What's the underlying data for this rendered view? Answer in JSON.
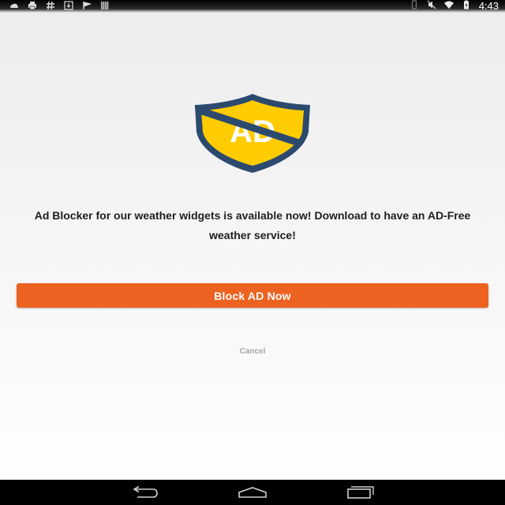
{
  "status_bar": {
    "time": "4:43",
    "left_icons": [
      "cloud-icon",
      "printer-icon",
      "hash-icon",
      "download-icon",
      "flag-icon",
      "barcode-icon"
    ],
    "right_icons": [
      "vibrate-icon",
      "mute-icon",
      "wifi-icon",
      "battery-icon"
    ]
  },
  "logo": {
    "text": "AD",
    "colors": {
      "shield_fill": "#ffcc00",
      "shield_border": "#2c4a6e",
      "text": "#ffffff"
    }
  },
  "dialog": {
    "message": "Ad Blocker for our weather widgets is available now! Download to have an AD-Free weather service!",
    "primary_button": "Block AD Now",
    "cancel_button": "Cancel"
  },
  "colors": {
    "accent": "#ec6220",
    "message_text": "#1e1e1e",
    "cancel_text": "#a8a8a8"
  },
  "nav_bar": {
    "buttons": [
      "back-icon",
      "home-icon",
      "recents-icon"
    ]
  }
}
